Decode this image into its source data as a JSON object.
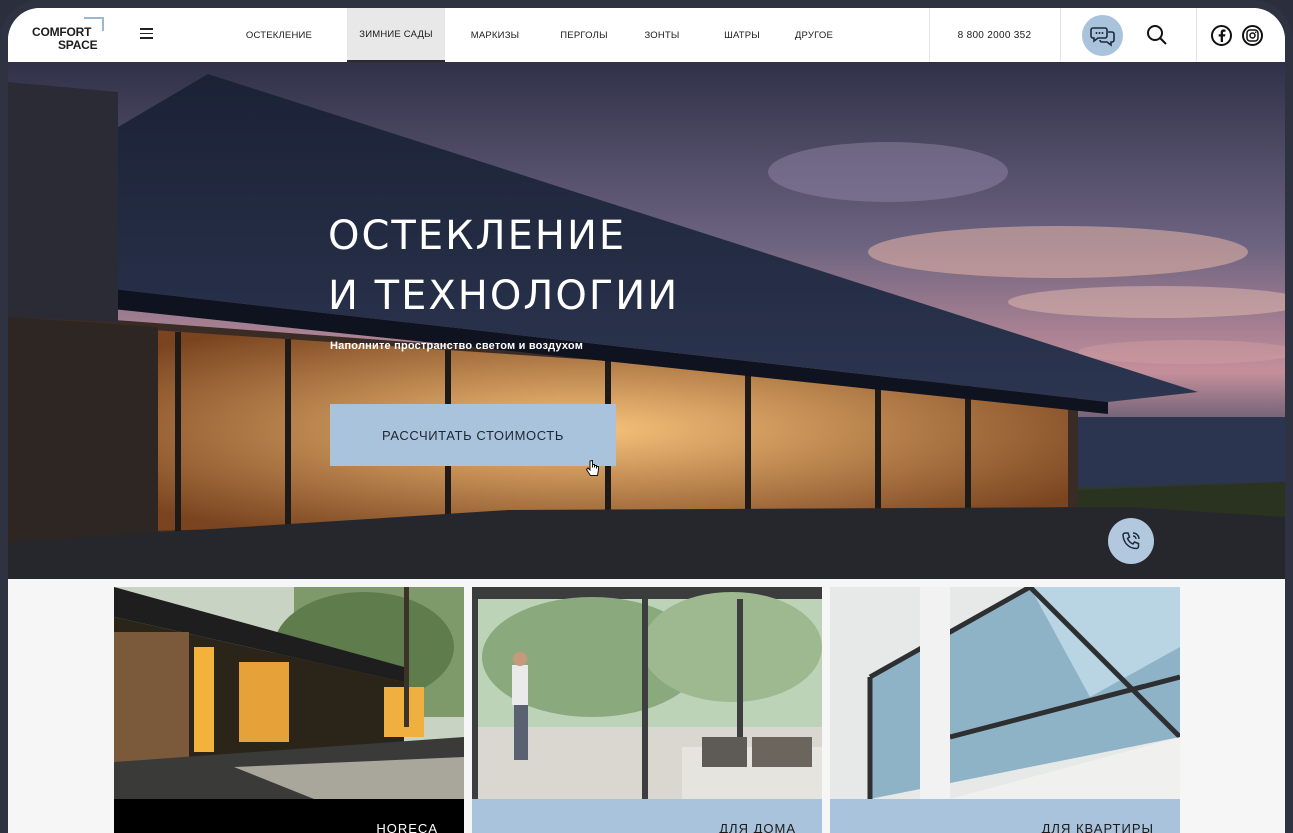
{
  "brand": {
    "line1": "COMFORT",
    "line2": "SPACE",
    "accent": "#9fb6d2"
  },
  "nav": {
    "items": [
      {
        "label": "ОСТЕКЛЕНИЕ"
      },
      {
        "label": "ЗИМНИЕ САДЫ",
        "active": true
      },
      {
        "label": "МАРКИЗЫ"
      },
      {
        "label": "ПЕРГОЛЫ"
      },
      {
        "label": "ЗОНТЫ"
      },
      {
        "label": "ШАТРЫ"
      },
      {
        "label": "ДРУГОЕ"
      }
    ]
  },
  "header": {
    "phone": "8 800 2000 352",
    "icons": [
      "menu-icon",
      "chat-icon",
      "search-icon",
      "facebook-icon",
      "instagram-icon"
    ]
  },
  "hero": {
    "title_line1": "ОСТЕКЛЕНИЕ",
    "title_line2": "И ТЕХНОЛОГИИ",
    "subtitle": "Наполните пространство светом и воздухом",
    "cta_label": "РАССЧИТАТЬ СТОИМОСТЬ",
    "accent": "#a9c3dc"
  },
  "cards": [
    {
      "label": "HORECA"
    },
    {
      "label": "ДЛЯ ДОМА"
    },
    {
      "label": "ДЛЯ КВАРТИРЫ"
    }
  ]
}
